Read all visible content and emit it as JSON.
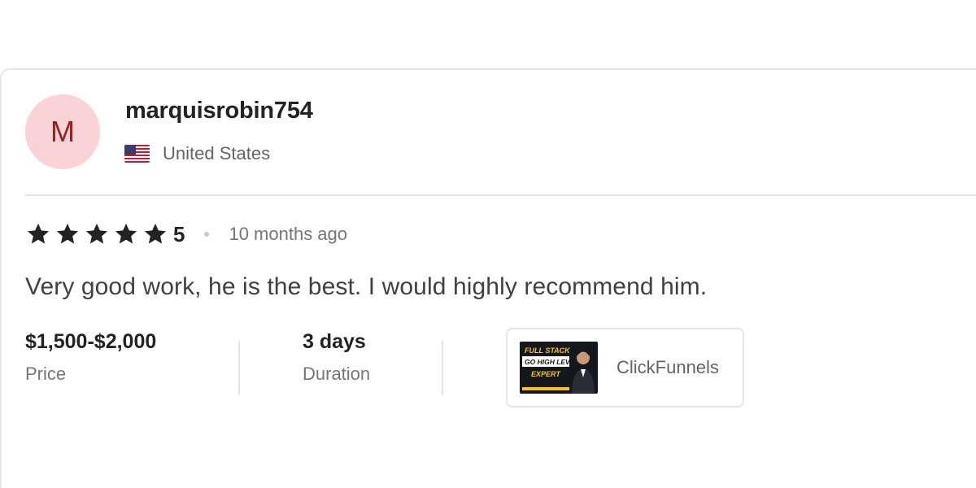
{
  "reviewer": {
    "avatar_letter": "M",
    "username": "marquisrobin754",
    "country": "United States",
    "flag_icon": "us-flag-icon"
  },
  "rating": {
    "stars": 5,
    "value": "5",
    "time_ago": "10 months ago"
  },
  "review": {
    "text": "Very good work, he is the best. I would highly recommend him."
  },
  "meta": {
    "price_value": "$1,500-$2,000",
    "price_label": "Price",
    "duration_value": "3 days",
    "duration_label": "Duration"
  },
  "gig": {
    "name": "ClickFunnels",
    "thumbnail_text": [
      "FULL STACK",
      "GO HIGH LEVEL",
      "EXPERT"
    ]
  },
  "colors": {
    "avatar_bg": "#fad4d4",
    "avatar_letter": "#9a2121",
    "thumb_bg": "#14171c",
    "thumb_accent": "#f5c518"
  }
}
